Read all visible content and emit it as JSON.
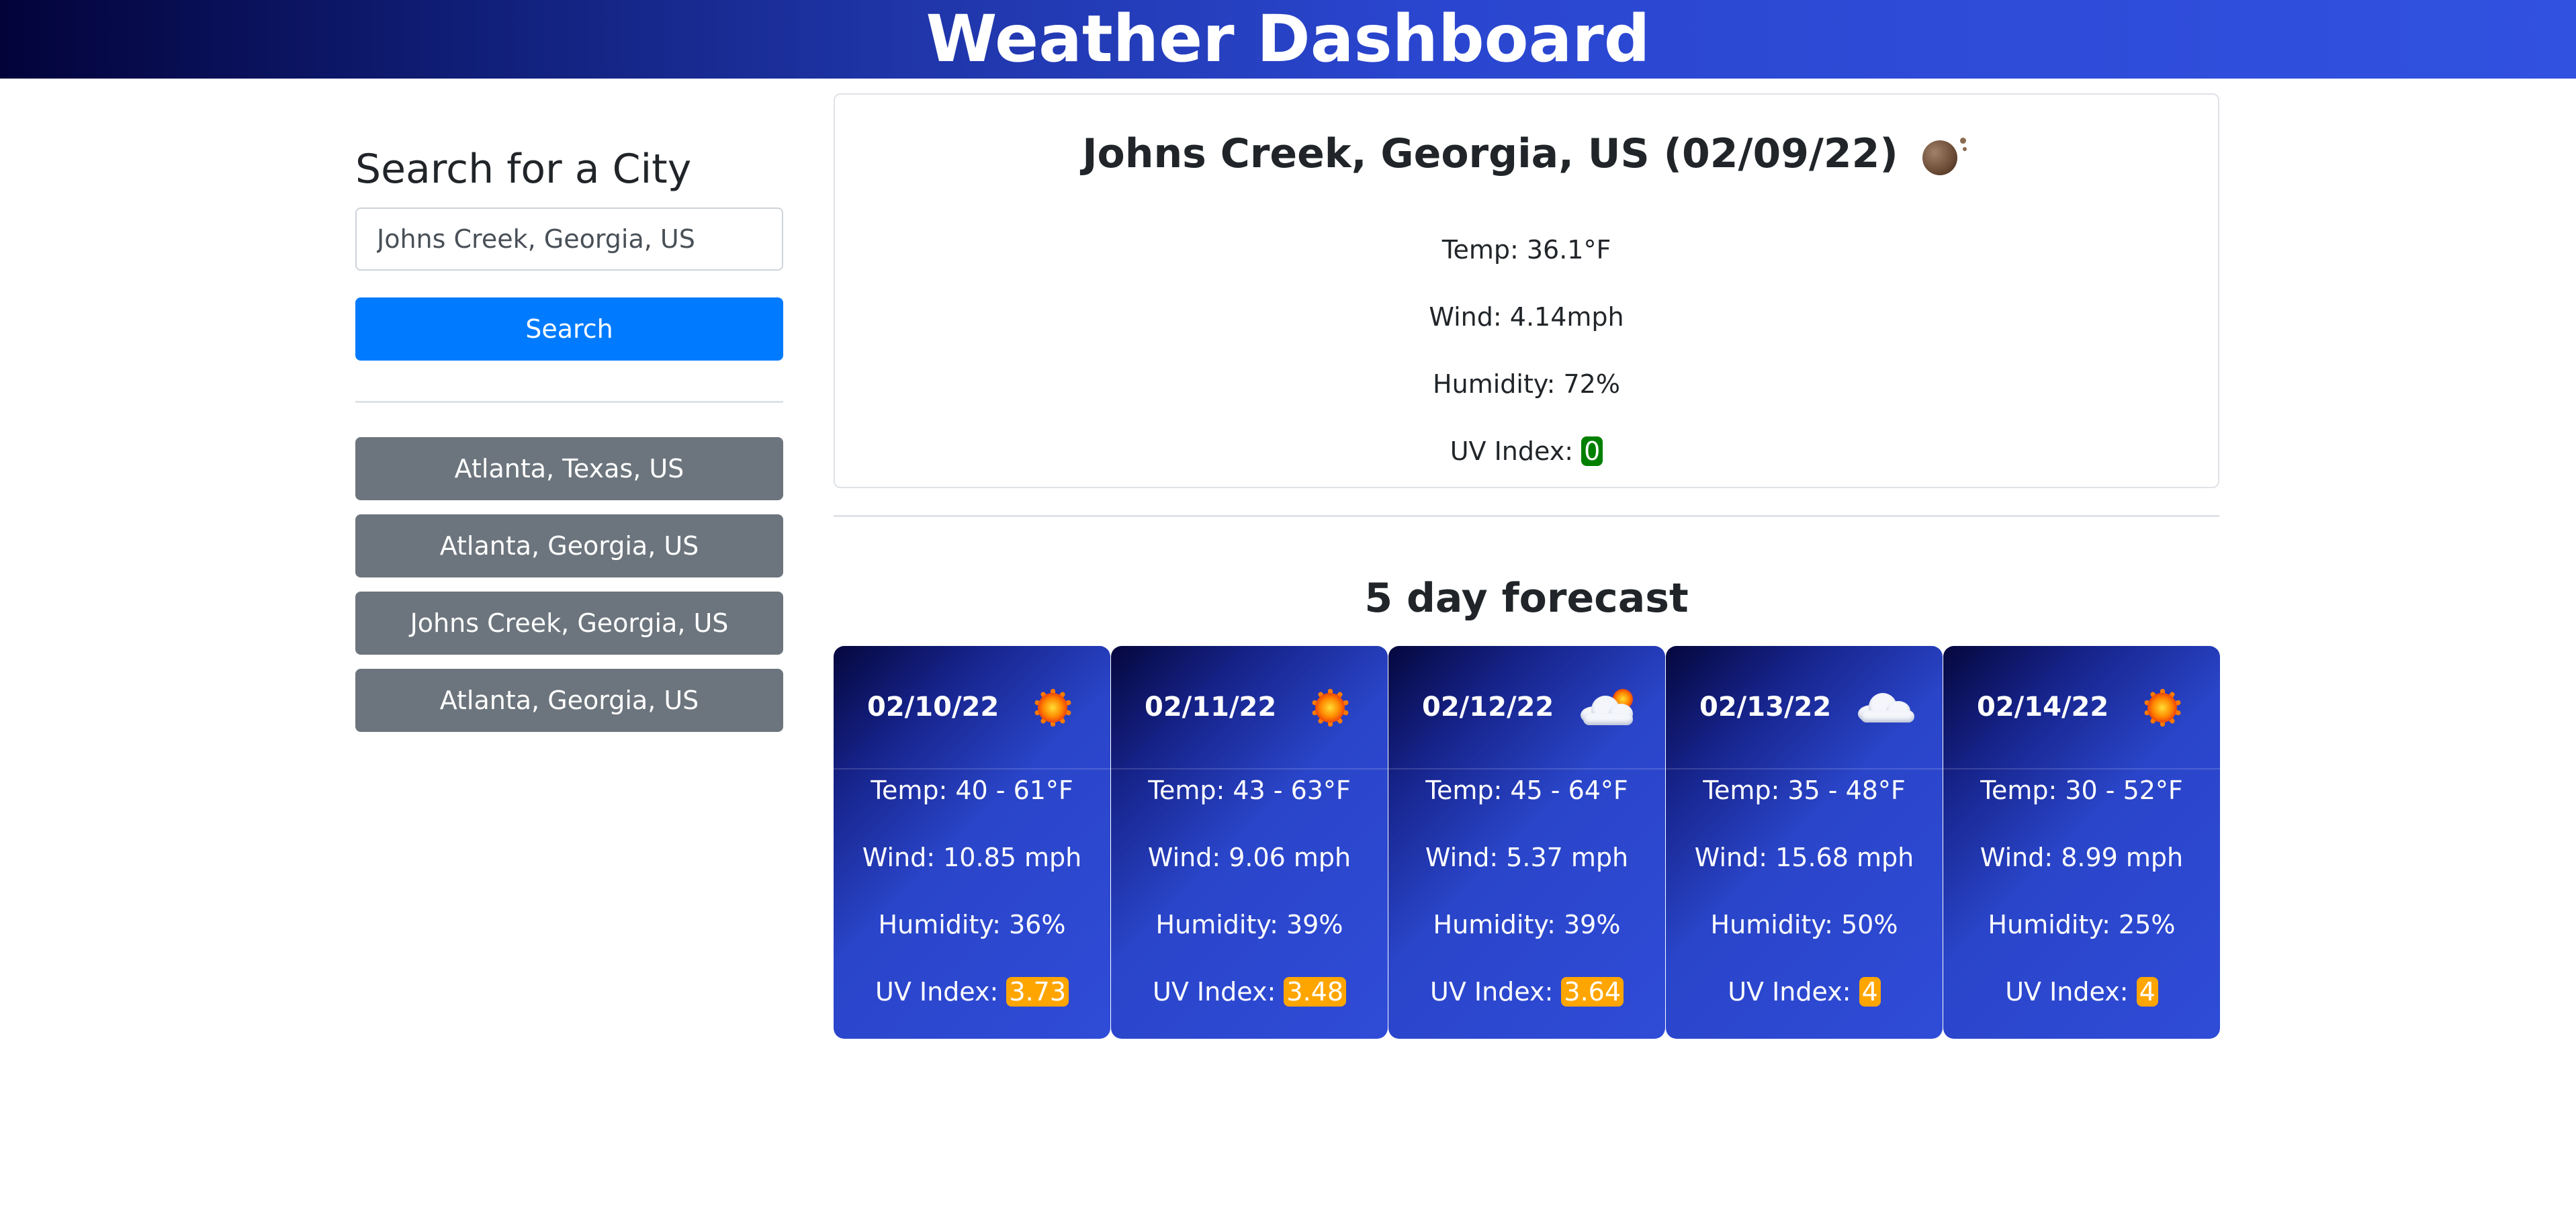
{
  "header": {
    "title": "Weather Dashboard"
  },
  "colors": {
    "accent": "#007bff",
    "history_button": "#6c757d",
    "uv_low": "#008000",
    "uv_moderate": "#ffa500"
  },
  "sidebar": {
    "heading": "Search for a City",
    "search_value": "Johns Creek, Georgia, US",
    "search_label": "Search",
    "history": [
      {
        "label": "Atlanta, Texas, US"
      },
      {
        "label": "Atlanta, Georgia, US"
      },
      {
        "label": "Johns Creek, Georgia, US"
      },
      {
        "label": "Atlanta, Georgia, US"
      }
    ]
  },
  "current": {
    "title": "Johns Creek, Georgia, US (02/09/22)",
    "icon": "moon-icon",
    "temp": "Temp: 36.1°F",
    "wind": "Wind: 4.14mph",
    "humidity": "Humidity: 72%",
    "uv_label": "UV Index: ",
    "uv_value": "0"
  },
  "forecast": {
    "title": "5 day forecast",
    "days": [
      {
        "date": "02/10/22",
        "icon": "sun-icon",
        "temp": "Temp: 40 - 61°F",
        "wind": "Wind: 10.85 mph",
        "humidity": "Humidity: 36%",
        "uv_label": "UV Index: ",
        "uv_value": "3.73"
      },
      {
        "date": "02/11/22",
        "icon": "sun-icon",
        "temp": "Temp: 43 - 63°F",
        "wind": "Wind: 9.06 mph",
        "humidity": "Humidity: 39%",
        "uv_label": "UV Index: ",
        "uv_value": "3.48"
      },
      {
        "date": "02/12/22",
        "icon": "cloud-sun-icon",
        "temp": "Temp: 45 - 64°F",
        "wind": "Wind: 5.37 mph",
        "humidity": "Humidity: 39%",
        "uv_label": "UV Index: ",
        "uv_value": "3.64"
      },
      {
        "date": "02/13/22",
        "icon": "cloud-icon",
        "temp": "Temp: 35 - 48°F",
        "wind": "Wind: 15.68 mph",
        "humidity": "Humidity: 50%",
        "uv_label": "UV Index: ",
        "uv_value": "4"
      },
      {
        "date": "02/14/22",
        "icon": "sun-icon",
        "temp": "Temp: 30 - 52°F",
        "wind": "Wind: 8.99 mph",
        "humidity": "Humidity: 25%",
        "uv_label": "UV Index: ",
        "uv_value": "4"
      }
    ]
  }
}
